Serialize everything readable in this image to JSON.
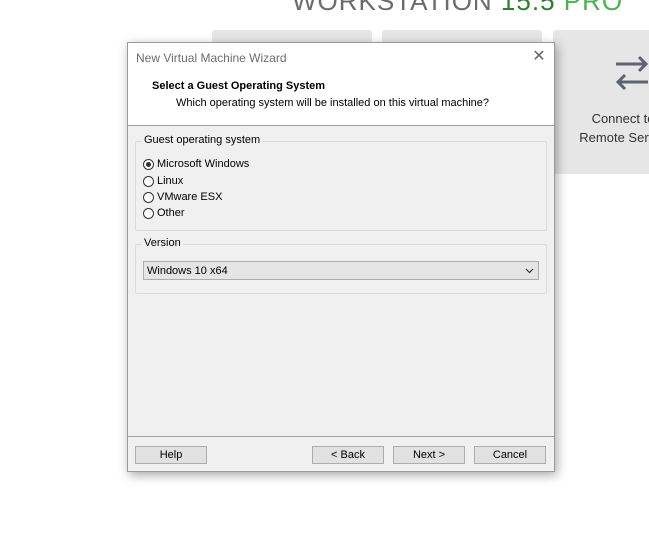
{
  "background": {
    "product_title_prefix": "WORKSTATION ",
    "product_version": "15.5",
    "product_edition": " PRO",
    "connect_line1": "Connect to",
    "connect_line2": "Remote Server"
  },
  "dialog": {
    "title": "New Virtual Machine Wizard",
    "close_glyph": "✕",
    "header_title": "Select a Guest Operating System",
    "header_subtitle": "Which operating system will be installed on this virtual machine?",
    "os_group_label": "Guest operating system",
    "os_options": [
      {
        "label": "Microsoft Windows",
        "checked": true
      },
      {
        "label": "Linux",
        "checked": false
      },
      {
        "label": "VMware ESX",
        "checked": false
      },
      {
        "label": "Other",
        "checked": false
      }
    ],
    "version_group_label": "Version",
    "version_value": "Windows 10 x64",
    "buttons": {
      "help": "Help",
      "back": "< Back",
      "next": "Next >",
      "cancel": "Cancel"
    }
  }
}
